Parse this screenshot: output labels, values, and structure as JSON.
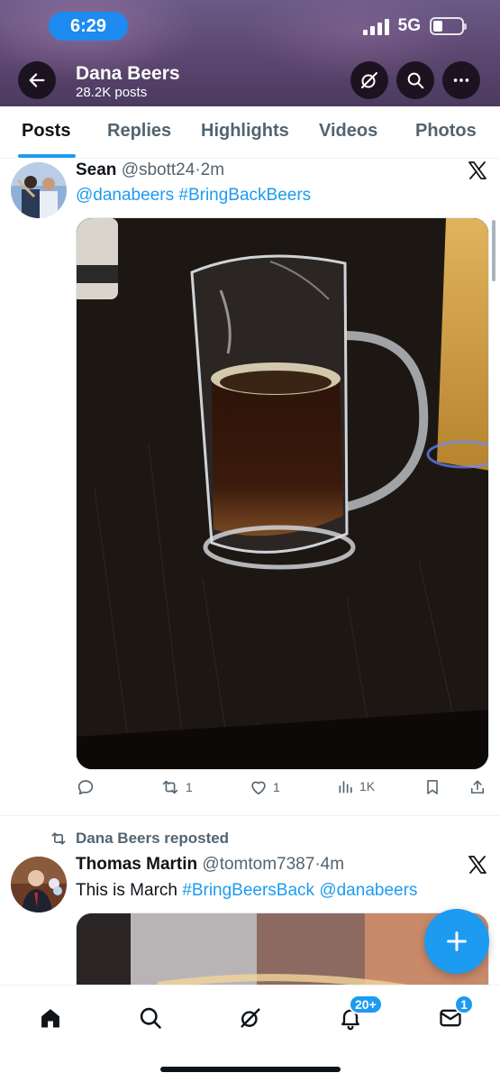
{
  "status_bar": {
    "time": "6:29",
    "network": "5G"
  },
  "header": {
    "name": "Dana Beers",
    "post_count": "28.2K posts",
    "icons": [
      "back-arrow-icon",
      "grok-icon",
      "search-icon",
      "more-icon"
    ],
    "banner_color": "#5b466f"
  },
  "tabs": [
    "Posts",
    "Replies",
    "Highlights",
    "Videos",
    "Photos"
  ],
  "active_tab": "Posts",
  "posts": [
    {
      "name": "Sean",
      "handle": "@sbott24",
      "dot": "·",
      "time": "2m",
      "text_mention": "@danabeers",
      "text_hashtag": "#BringBackBeers",
      "stats": {
        "replies": "",
        "reposts": "1",
        "likes": "1",
        "views": "1K"
      }
    },
    {
      "repost_label": "Dana Beers reposted",
      "name": "Thomas Martin",
      "handle": "@tomtom7387",
      "dot": "·",
      "time": "4m",
      "text_plain": "This is March",
      "text_hashtag": "#BringBeersBack",
      "text_mention": "@danabeers"
    }
  ],
  "bottom_nav": {
    "items": [
      "home-icon",
      "search-icon",
      "grok-icon",
      "notifications-icon",
      "messages-icon"
    ],
    "notifications_badge": "20+",
    "messages_badge": "1"
  },
  "colors": {
    "accent": "#1d9bf0",
    "text": "#0f1419",
    "secondary": "#536471"
  }
}
